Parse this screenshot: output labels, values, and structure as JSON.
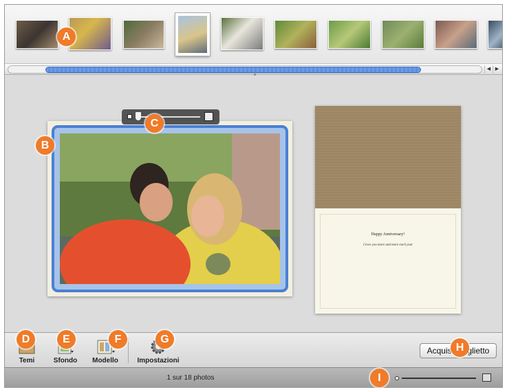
{
  "photo_strip": {
    "thumbnails": [
      "photo-1",
      "photo-2",
      "photo-3",
      "photo-4",
      "photo-5",
      "photo-6",
      "photo-7",
      "photo-8",
      "photo-9",
      "photo-10"
    ],
    "selected_index": 3
  },
  "card": {
    "greeting": "Happy Anniversary!",
    "message": "I love you more and more each year"
  },
  "toolbar": {
    "themes_label": "Temi",
    "background_label": "Sfondo",
    "layout_label": "Modello",
    "settings_label": "Impostazioni",
    "buy_label": "Acquista biglietto"
  },
  "status": {
    "text": "1 sur 18 photos"
  },
  "callouts": {
    "a": "A",
    "b": "B",
    "c": "C",
    "d": "D",
    "e": "E",
    "f": "F",
    "g": "G",
    "h": "H",
    "i": "I"
  },
  "colors": {
    "callout": "#f07b28",
    "selection": "#4a80d6",
    "scroll_thumb": "#5b8ee0"
  }
}
